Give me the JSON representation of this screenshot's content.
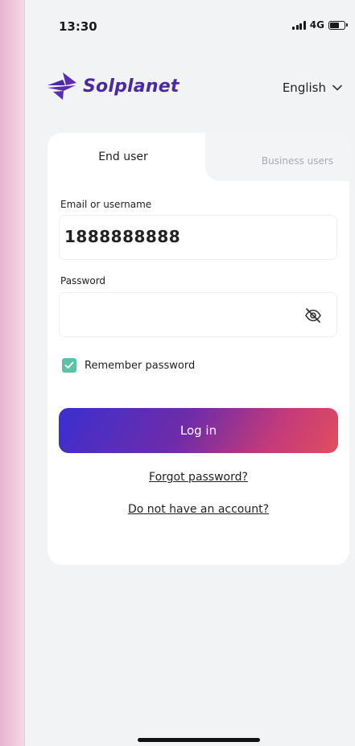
{
  "status_bar": {
    "time": "13:30",
    "network": "4G"
  },
  "header": {
    "brand": "Solplanet",
    "language": "English"
  },
  "tabs": [
    {
      "label": "End user",
      "active": true
    },
    {
      "label": "Business users",
      "active": false
    }
  ],
  "form": {
    "username_label": "Email or username",
    "username_value": "1888888888",
    "password_label": "Password",
    "password_value": "",
    "remember_label": "Remember password",
    "remember_checked": true
  },
  "actions": {
    "login_label": "Log in",
    "forgot_label": "Forgot password?",
    "signup_label": "Do not have an account?"
  },
  "colors": {
    "brand": "#4a2aa4",
    "checkbox": "#5bc2a8",
    "button_gradient_start": "#3b2fd0",
    "button_gradient_end": "#e34d5e"
  },
  "icons": [
    "signal-icon",
    "battery-icon",
    "chevron-down-icon",
    "eye-off-icon",
    "check-icon"
  ]
}
